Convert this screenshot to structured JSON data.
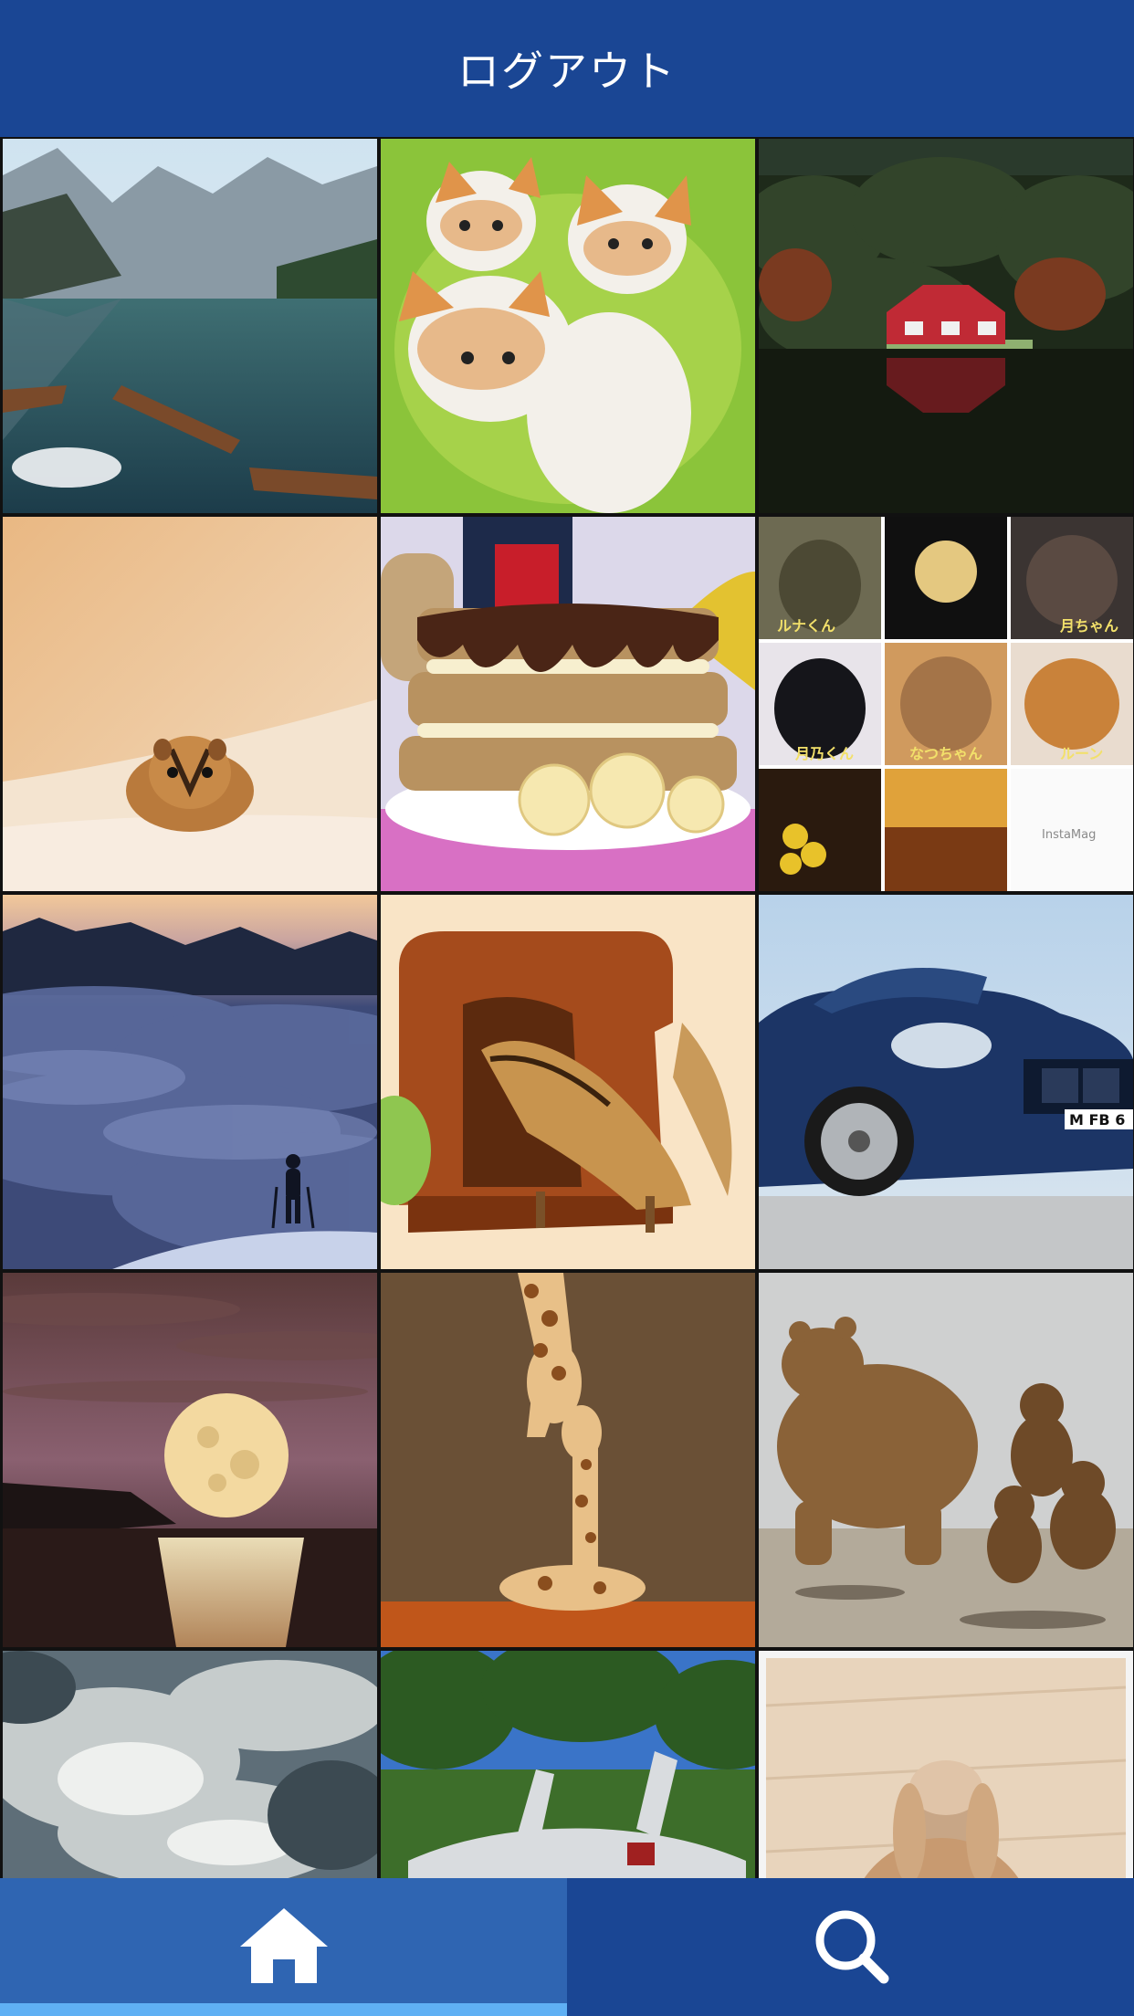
{
  "header": {
    "title": "ログアウト"
  },
  "grid": {
    "tiles": [
      {
        "subject": "mountain-lake-with-boats"
      },
      {
        "subject": "three-kittens"
      },
      {
        "subject": "red-house-by-lake"
      },
      {
        "subject": "chipmunk-peeking"
      },
      {
        "subject": "banana-chocolate-toast-stack"
      },
      {
        "subject": "instagram-cat-collage"
      },
      {
        "subject": "hiker-above-sea-of-clouds"
      },
      {
        "subject": "chipmunk-in-plush-house"
      },
      {
        "subject": "blue-convertible-car"
      },
      {
        "subject": "full-moon-over-sea"
      },
      {
        "subject": "giraffe-mother-and-calf"
      },
      {
        "subject": "bear-with-cubs"
      },
      {
        "subject": "cloudy-sky"
      },
      {
        "subject": "silver-sports-car"
      },
      {
        "subject": "rabbit-with-bunny-on-head"
      }
    ]
  },
  "collage": {
    "label_1": "ルナくん",
    "label_2": "月ちゃん",
    "label_3": "月乃くん",
    "label_4": "なつちゃん",
    "label_5": "ルーン",
    "watermark": "InstaMag"
  },
  "car": {
    "plate": "M FB 6"
  },
  "tabbar": {
    "tabs": [
      {
        "icon": "home-icon",
        "selected": true
      },
      {
        "icon": "search-icon",
        "selected": false
      }
    ]
  },
  "colors": {
    "header_bg": "#1a4694",
    "tab_selected_bg": "#2f65b2",
    "tab_bg": "#1a4694",
    "tab_indicator": "#5fb0f4"
  }
}
